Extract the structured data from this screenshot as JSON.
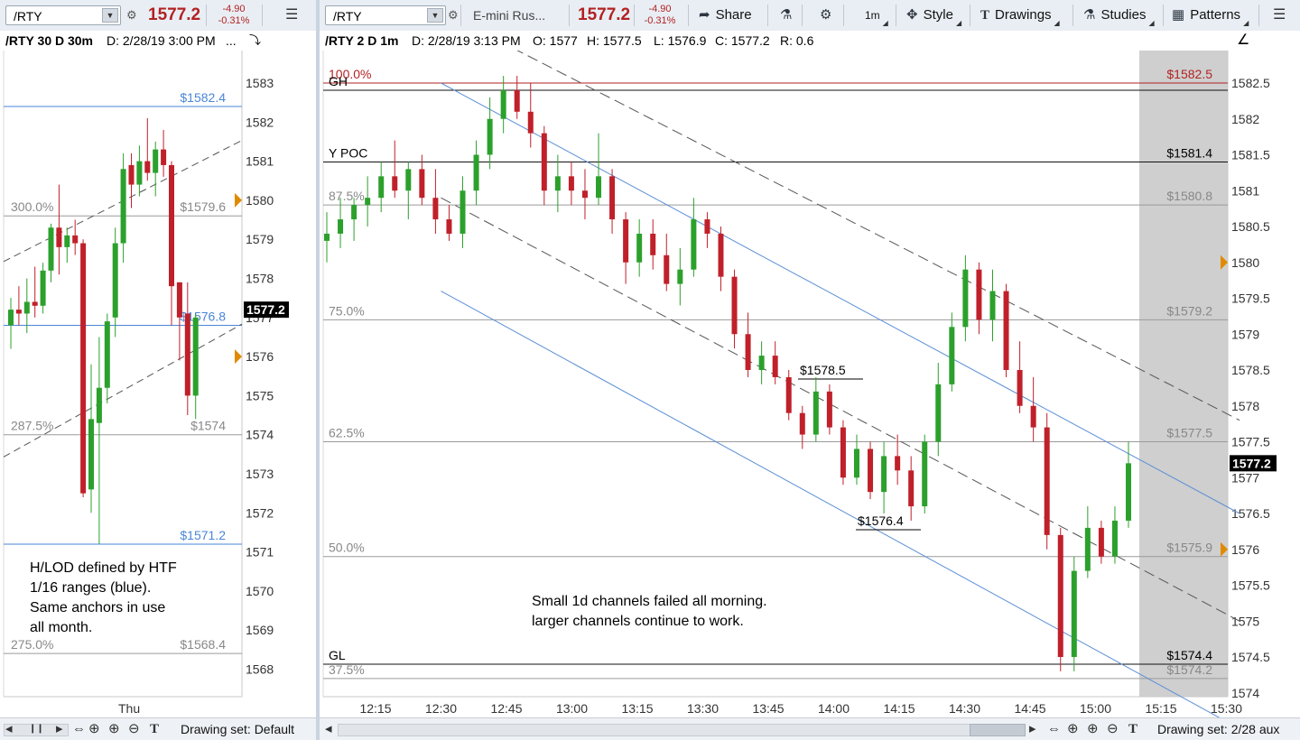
{
  "left": {
    "toolbar": {
      "symbol": "/RTY",
      "price": "1577.2",
      "change": "-4.90",
      "change_pct": "-0.31%"
    },
    "info": {
      "title": "/RTY 30 D 30m",
      "date": "D: 2/28/19 3:00 PM",
      "more": "..."
    },
    "note": "H/LOD defined by HTF\n1/16 ranges (blue).\nSame anchors in use\nall month.",
    "bottom": {
      "drawing_set": "Drawing set: Default"
    }
  },
  "right": {
    "toolbar": {
      "symbol": "/RTY",
      "description": "E-mini Rus...",
      "price": "1577.2",
      "change": "-4.90",
      "change_pct": "-0.31%",
      "share": "Share",
      "style": "Style",
      "drawings": "Drawings",
      "studies": "Studies",
      "patterns": "Patterns",
      "interval": "1m"
    },
    "info": {
      "title": "/RTY 2 D 1m",
      "date": "D: 2/28/19 3:13 PM",
      "open": "O: 1577",
      "high": "H: 1577.5",
      "low": "L: 1576.9",
      "close": "C: 1577.2",
      "range": "R: 0.6"
    },
    "note": "Small 1d channels failed all morning.\nlarger channels continue to work.",
    "bottom": {
      "drawing_set": "Drawing set: 2/28 aux"
    }
  },
  "icons": [
    "settings-icon",
    "lock-icon",
    "menu-icon",
    "drawing-tool-icon",
    "share-icon",
    "flask-icon",
    "gear-icon",
    "cursor-icon",
    "text-icon",
    "studies-icon",
    "patterns-icon",
    "zoom-in-icon",
    "zoom-out-icon",
    "crosshair-icon"
  ],
  "colors": {
    "up": "#2ca02c",
    "down": "#c0202a",
    "channel_blue": "#5b8fd6",
    "price_red": "#b22222",
    "expansion_shade": "#cfcfcf"
  },
  "chart_data": [
    {
      "type": "candlestick",
      "title": "/RTY 30 D 30m",
      "ylim": [
        1567.5,
        1583.5
      ],
      "y_ticks": [
        1568,
        1569,
        1570,
        1571,
        1572,
        1573,
        1574,
        1575,
        1576,
        1577,
        1578,
        1579,
        1580,
        1581,
        1582,
        1583
      ],
      "x_tick_labels": [
        "Thu"
      ],
      "last_price": "1577.2",
      "candles": [
        [
          1576.8,
          1577.5,
          1576.2,
          1577.2
        ],
        [
          1577.2,
          1577.8,
          1576.8,
          1577.1
        ],
        [
          1577.1,
          1578.0,
          1576.6,
          1577.4
        ],
        [
          1577.4,
          1578.3,
          1577.0,
          1577.3
        ],
        [
          1577.3,
          1578.4,
          1577.1,
          1578.2
        ],
        [
          1578.2,
          1579.4,
          1577.9,
          1579.3
        ],
        [
          1579.3,
          1580.4,
          1578.1,
          1578.8
        ],
        [
          1578.8,
          1579.3,
          1578.4,
          1579.1
        ],
        [
          1579.1,
          1579.5,
          1578.6,
          1578.9
        ],
        [
          1578.9,
          1579.0,
          1572.4,
          1572.5
        ],
        [
          1572.6,
          1575.8,
          1572.0,
          1574.4
        ],
        [
          1574.3,
          1576.5,
          1571.2,
          1575.2
        ],
        [
          1575.2,
          1577.1,
          1574.8,
          1576.9
        ],
        [
          1577.0,
          1579.3,
          1576.5,
          1578.9
        ],
        [
          1578.9,
          1581.2,
          1578.4,
          1580.8
        ],
        [
          1580.9,
          1581.2,
          1579.8,
          1580.4
        ],
        [
          1580.4,
          1581.4,
          1580.1,
          1581.0
        ],
        [
          1581.0,
          1582.1,
          1580.5,
          1580.7
        ],
        [
          1580.7,
          1581.5,
          1580.1,
          1581.3
        ],
        [
          1581.3,
          1581.8,
          1580.6,
          1580.9
        ],
        [
          1580.9,
          1581.0,
          1576.8,
          1577.8
        ],
        [
          1577.9,
          1577.9,
          1575.9,
          1577.0
        ],
        [
          1577.1,
          1577.9,
          1574.5,
          1575.0
        ],
        [
          1575.0,
          1577.1,
          1574.4,
          1577.0
        ]
      ],
      "levels": [
        {
          "label": "$1582.4",
          "value": 1582.4,
          "kind": "blue"
        },
        {
          "label": "300.0%",
          "right_label": "$1579.6",
          "value": 1579.6,
          "kind": "grey"
        },
        {
          "label": "$1576.8",
          "value": 1576.8,
          "kind": "blue"
        },
        {
          "label": "287.5%",
          "right_label": "$1574",
          "value": 1574.0,
          "kind": "grey"
        },
        {
          "label": "$1571.2",
          "value": 1571.2,
          "kind": "blue"
        },
        {
          "label": "275.0%",
          "right_label": "$1568.4",
          "value": 1568.4,
          "kind": "grey"
        }
      ],
      "channel": [
        [
          0,
          1578.2,
          24,
          1581.3
        ],
        [
          0,
          1573.2,
          24,
          1576.6
        ]
      ]
    },
    {
      "type": "candlestick",
      "title": "/RTY 2 D 1m",
      "ylim": [
        1574.0,
        1582.7
      ],
      "y_ticks": [
        1574,
        1574.5,
        1575,
        1575.5,
        1576,
        1576.5,
        1577,
        1577.5,
        1578,
        1578.5,
        1579,
        1579.5,
        1580,
        1580.5,
        1581,
        1581.5,
        1582,
        1582.5
      ],
      "x_tick_labels": [
        "12:15",
        "12:30",
        "12:45",
        "13:00",
        "13:15",
        "13:30",
        "13:45",
        "14:00",
        "14:15",
        "14:30",
        "14:45",
        "15:00",
        "15:15",
        "15:30"
      ],
      "last_price": "1577.2",
      "levels": [
        {
          "label": "100.0%",
          "right_label": "$1582.5",
          "value": 1582.5,
          "kind": "red"
        },
        {
          "label": "GH",
          "value": 1582.4,
          "kind": "black"
        },
        {
          "label": "Y POC",
          "right_label": "$1581.4",
          "value": 1581.4,
          "kind": "black"
        },
        {
          "label": "87.5%",
          "right_label": "$1580.8",
          "value": 1580.8,
          "kind": "grey"
        },
        {
          "label": "75.0%",
          "right_label": "$1579.2",
          "value": 1579.2,
          "kind": "grey"
        },
        {
          "label": "62.5%",
          "right_label": "$1577.5",
          "value": 1577.5,
          "kind": "grey"
        },
        {
          "label": "50.0%",
          "right_label": "$1575.9",
          "value": 1575.9,
          "kind": "grey"
        },
        {
          "label": "GL",
          "right_label": "$1574.4",
          "value": 1574.4,
          "kind": "black"
        },
        {
          "label": "37.5%",
          "right_label": "$1574.2",
          "value": 1574.2,
          "kind": "grey"
        }
      ],
      "annotations": [
        {
          "label": "$1578.5",
          "value": 1578.5,
          "time": "13:40"
        },
        {
          "label": "$1576.4",
          "value": 1576.4,
          "time": "14:05"
        }
      ],
      "candles": [
        [
          1580.3,
          1580.7,
          1580.0,
          1580.4
        ],
        [
          1580.4,
          1580.9,
          1580.2,
          1580.6
        ],
        [
          1580.6,
          1580.9,
          1580.3,
          1580.8
        ],
        [
          1580.8,
          1581.2,
          1580.5,
          1580.9
        ],
        [
          1580.9,
          1581.4,
          1580.7,
          1581.2
        ],
        [
          1581.2,
          1581.7,
          1580.9,
          1581.0
        ],
        [
          1581.0,
          1581.4,
          1580.6,
          1581.3
        ],
        [
          1581.3,
          1581.5,
          1580.8,
          1580.9
        ],
        [
          1580.9,
          1581.3,
          1580.4,
          1580.6
        ],
        [
          1580.6,
          1580.8,
          1580.3,
          1580.4
        ],
        [
          1580.4,
          1581.2,
          1580.2,
          1581.0
        ],
        [
          1581.0,
          1581.7,
          1580.8,
          1581.5
        ],
        [
          1581.5,
          1582.3,
          1581.3,
          1582.0
        ],
        [
          1582.0,
          1582.6,
          1581.8,
          1582.4
        ],
        [
          1582.4,
          1582.6,
          1582.0,
          1582.1
        ],
        [
          1582.1,
          1582.5,
          1581.6,
          1581.8
        ],
        [
          1581.8,
          1581.9,
          1580.8,
          1581.0
        ],
        [
          1581.0,
          1581.5,
          1580.7,
          1581.2
        ],
        [
          1581.2,
          1581.4,
          1580.8,
          1581.0
        ],
        [
          1581.0,
          1581.3,
          1580.6,
          1580.9
        ],
        [
          1580.9,
          1581.8,
          1580.8,
          1581.2
        ],
        [
          1581.2,
          1581.3,
          1580.4,
          1580.6
        ],
        [
          1580.6,
          1580.7,
          1579.7,
          1580.0
        ],
        [
          1580.0,
          1580.6,
          1579.8,
          1580.4
        ],
        [
          1580.4,
          1580.6,
          1579.9,
          1580.1
        ],
        [
          1580.1,
          1580.4,
          1579.6,
          1579.7
        ],
        [
          1579.7,
          1580.2,
          1579.4,
          1579.9
        ],
        [
          1579.9,
          1580.9,
          1579.8,
          1580.6
        ],
        [
          1580.6,
          1580.7,
          1580.2,
          1580.4
        ],
        [
          1580.4,
          1580.5,
          1579.6,
          1579.8
        ],
        [
          1579.8,
          1579.9,
          1578.8,
          1579.0
        ],
        [
          1579.0,
          1579.3,
          1578.4,
          1578.5
        ],
        [
          1578.5,
          1578.9,
          1578.3,
          1578.7
        ],
        [
          1578.7,
          1578.9,
          1578.3,
          1578.4
        ],
        [
          1578.4,
          1578.5,
          1577.8,
          1577.9
        ],
        [
          1577.9,
          1578.0,
          1577.4,
          1577.6
        ],
        [
          1577.6,
          1578.4,
          1577.5,
          1578.2
        ],
        [
          1578.2,
          1578.3,
          1577.6,
          1577.7
        ],
        [
          1577.7,
          1577.8,
          1576.9,
          1577.0
        ],
        [
          1577.0,
          1577.6,
          1576.9,
          1577.4
        ],
        [
          1577.4,
          1577.5,
          1576.7,
          1576.8
        ],
        [
          1576.8,
          1577.5,
          1576.5,
          1577.3
        ],
        [
          1577.3,
          1577.6,
          1576.9,
          1577.1
        ],
        [
          1577.1,
          1577.3,
          1576.4,
          1576.6
        ],
        [
          1576.6,
          1577.6,
          1576.5,
          1577.5
        ],
        [
          1577.5,
          1578.6,
          1577.3,
          1578.3
        ],
        [
          1578.3,
          1579.3,
          1578.2,
          1579.1
        ],
        [
          1579.1,
          1580.1,
          1578.9,
          1579.9
        ],
        [
          1579.9,
          1580.0,
          1579.0,
          1579.2
        ],
        [
          1579.2,
          1579.9,
          1578.9,
          1579.6
        ],
        [
          1579.6,
          1579.7,
          1578.4,
          1578.5
        ],
        [
          1578.5,
          1578.9,
          1577.9,
          1578.0
        ],
        [
          1578.0,
          1578.4,
          1577.5,
          1577.7
        ],
        [
          1577.7,
          1577.9,
          1576.0,
          1576.2
        ],
        [
          1576.2,
          1576.3,
          1574.3,
          1574.5
        ],
        [
          1574.5,
          1575.9,
          1574.3,
          1575.7
        ],
        [
          1575.7,
          1576.6,
          1575.6,
          1576.3
        ],
        [
          1576.3,
          1576.4,
          1575.8,
          1575.9
        ],
        [
          1575.9,
          1576.6,
          1575.8,
          1576.4
        ],
        [
          1576.4,
          1577.5,
          1576.3,
          1577.2
        ]
      ],
      "channels": [
        {
          "style": "solid-blue",
          "from": [
            12.5,
            1582.5
          ],
          "to": [
            15.55,
            1576.5
          ]
        },
        {
          "style": "solid-blue",
          "from": [
            12.5,
            1579.6
          ],
          "to": [
            15.55,
            1573.5
          ]
        },
        {
          "style": "dashed",
          "from": [
            12.5,
            1580.9
          ],
          "to": [
            15.55,
            1575.0
          ]
        },
        {
          "style": "dashed",
          "from": [
            12.5,
            1583.5
          ],
          "to": [
            15.55,
            1577.8
          ]
        }
      ]
    }
  ]
}
